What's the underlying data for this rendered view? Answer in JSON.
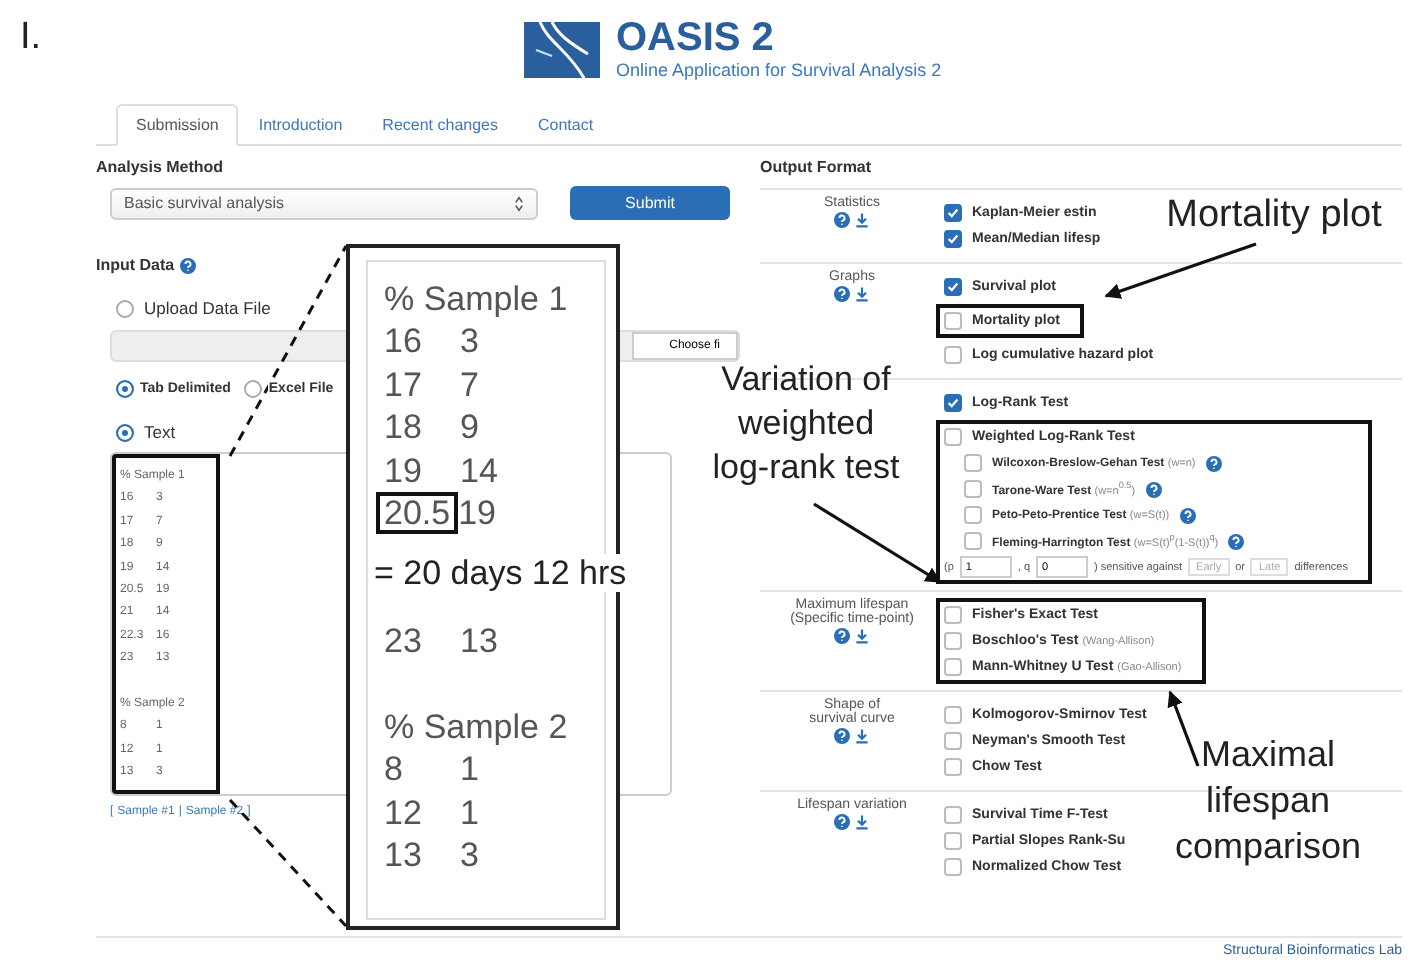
{
  "figure_label": "I.",
  "header": {
    "title": "OASIS 2",
    "subtitle": "Online Application for Survival Analysis 2"
  },
  "tabs": [
    {
      "label": "Submission",
      "selected": true
    },
    {
      "label": "Introduction",
      "selected": false
    },
    {
      "label": "Recent changes",
      "selected": false
    },
    {
      "label": "Contact",
      "selected": false
    }
  ],
  "analysis_method": {
    "label": "Analysis Method",
    "value": "Basic survival analysis",
    "button": "Submit"
  },
  "input_data": {
    "label": "Input Data",
    "upload": {
      "label": "Upload Data File",
      "selected": false
    },
    "file_button": "Choose fi",
    "file_types": [
      {
        "label": "Tab Delimited",
        "selected": true
      },
      {
        "label": "Excel File",
        "selected": false
      }
    ],
    "text": {
      "label": "Text",
      "selected": true
    },
    "highlighted": true,
    "text_lines": [
      {
        "kind": "heading",
        "cols": [
          "% Sample 1"
        ]
      },
      {
        "kind": "data",
        "cols": [
          "16",
          "3"
        ]
      },
      {
        "kind": "data",
        "cols": [
          "17",
          "7"
        ]
      },
      {
        "kind": "data",
        "cols": [
          "18",
          "9"
        ]
      },
      {
        "kind": "data",
        "cols": [
          "19",
          "14"
        ]
      },
      {
        "kind": "data",
        "cols": [
          "20.5",
          "19"
        ]
      },
      {
        "kind": "data",
        "cols": [
          "21",
          "14"
        ]
      },
      {
        "kind": "data",
        "cols": [
          "22.3",
          "16"
        ]
      },
      {
        "kind": "data",
        "cols": [
          "23",
          "13"
        ]
      },
      {
        "kind": "blank"
      },
      {
        "kind": "heading",
        "cols": [
          "% Sample 2"
        ]
      },
      {
        "kind": "data",
        "cols": [
          "8",
          "1"
        ]
      },
      {
        "kind": "data",
        "cols": [
          "12",
          "1"
        ]
      },
      {
        "kind": "data",
        "cols": [
          "13",
          "3"
        ]
      }
    ],
    "sample_links": {
      "open": "[",
      "items": [
        "Sample #1",
        "Sample #2"
      ],
      "separator": "|",
      "close": "]"
    }
  },
  "magnified_view": {
    "lines": [
      {
        "kind": "heading",
        "cols": [
          "% Sample 1"
        ]
      },
      {
        "kind": "data",
        "cols": [
          "16",
          "3"
        ]
      },
      {
        "kind": "data",
        "cols": [
          "17",
          "7"
        ]
      },
      {
        "kind": "data",
        "cols": [
          "18",
          "9"
        ]
      },
      {
        "kind": "data",
        "cols": [
          "19",
          "14"
        ]
      },
      {
        "kind": "data",
        "cols": [
          "20.5",
          "19"
        ],
        "highlighted": true
      },
      {
        "kind": "blank"
      },
      {
        "kind": "blank"
      },
      {
        "kind": "data",
        "cols": [
          "23",
          "13"
        ]
      },
      {
        "kind": "blank"
      },
      {
        "kind": "heading",
        "cols": [
          "% Sample 2"
        ]
      },
      {
        "kind": "data",
        "cols": [
          "8",
          "1"
        ]
      },
      {
        "kind": "data",
        "cols": [
          "12",
          "1"
        ]
      },
      {
        "kind": "data",
        "cols": [
          "13",
          "3"
        ]
      }
    ]
  },
  "output_format": {
    "title": "Output Format",
    "sections": [
      {
        "label": [
          "Statistics"
        ],
        "icons": true,
        "groups": [
          {
            "highlighted": false,
            "options": [
              {
                "kind": "check",
                "label": "Kaplan-Meier estin",
                "checked": true
              },
              {
                "kind": "check",
                "label": "Mean/Median lifesp",
                "checked": true
              }
            ]
          }
        ]
      },
      {
        "label": [
          "Graphs"
        ],
        "icons": true,
        "groups": [
          {
            "highlighted": false,
            "options": [
              {
                "kind": "check",
                "label": "Survival plot",
                "checked": true
              }
            ]
          },
          {
            "highlighted": true,
            "options": [
              {
                "kind": "check",
                "label": "Mortality plot",
                "checked": false
              }
            ]
          },
          {
            "highlighted": false,
            "options": [
              {
                "kind": "check",
                "label": "Log cumulative hazard plot",
                "checked": false
              }
            ]
          }
        ]
      },
      {
        "groups": [
          {
            "highlighted": false,
            "options": [
              {
                "kind": "check",
                "label": "Log-Rank Test",
                "checked": true
              }
            ]
          },
          {
            "highlighted": true,
            "options": [
              {
                "kind": "check",
                "label": "Weighted Log-Rank Test",
                "checked": false
              },
              {
                "kind": "sub",
                "label": "Wilcoxon-Breslow-Gehan Test",
                "note": "(w=n)",
                "checked": false
              },
              {
                "kind": "sub",
                "label": "Tarone-Ware Test",
                "note": "(w=n$^{0.5}$)",
                "checked": false
              },
              {
                "kind": "sub",
                "label": "Peto-Peto-Prentice Test",
                "note": "(w=S(t))",
                "checked": false
              },
              {
                "kind": "sub",
                "label": "Fleming-Harrington Test",
                "note": "(w=S(t)$^{p}$(1-S(t))$^{q}$)",
                "checked": false
              },
              {
                "kind": "params",
                "p_label": "(p",
                "p": "1",
                "q_label": ", q",
                "q": "0",
                "middle": ") sensitive against",
                "early": "Early",
                "or": "or",
                "late": "Late",
                "end": "differences"
              }
            ]
          }
        ]
      },
      {
        "label": [
          "Maximum lifespan",
          "(Specific time-point)"
        ],
        "icons": true,
        "groups": [
          {
            "highlighted": true,
            "options": [
              {
                "kind": "check",
                "label": "Fisher's Exact Test",
                "checked": false
              },
              {
                "kind": "check",
                "label": "Boschloo's Test",
                "note": "(Wang-Allison)",
                "checked": false
              },
              {
                "kind": "check",
                "label": "Mann-Whitney U Test",
                "note": "(Gao-Allison)",
                "checked": false
              }
            ]
          }
        ]
      },
      {
        "label": [
          "Shape of",
          "survival curve"
        ],
        "icons": true,
        "groups": [
          {
            "highlighted": false,
            "options": [
              {
                "kind": "check",
                "label": "Kolmogorov-Smirnov Test",
                "checked": false
              },
              {
                "kind": "check",
                "label": "Neyman's Smooth Test",
                "checked": false
              },
              {
                "kind": "check",
                "label": "Chow Test",
                "checked": false
              }
            ]
          }
        ]
      },
      {
        "label": [
          "Lifespan variation"
        ],
        "icons": true,
        "groups": [
          {
            "highlighted": false,
            "options": [
              {
                "kind": "check",
                "label": "Survival Time F-Test",
                "checked": false
              },
              {
                "kind": "check",
                "label": "Partial Slopes Rank-Su",
                "checked": false
              },
              {
                "kind": "check",
                "label": "Normalized Chow Test",
                "checked": false
              }
            ]
          }
        ]
      }
    ]
  },
  "annotations": [
    {
      "kind": "callout",
      "lines": [
        "Mortality plot"
      ]
    },
    {
      "kind": "callout",
      "lines": [
        "Variation of",
        "weighted",
        "log-rank test"
      ]
    },
    {
      "kind": "conversion",
      "lines": [
        "= 20 days 12 hrs"
      ]
    },
    {
      "kind": "callout",
      "lines": [
        "Maximal",
        "lifespan",
        "comparison"
      ]
    }
  ],
  "footer": "Structural Bioinformatics Lab"
}
